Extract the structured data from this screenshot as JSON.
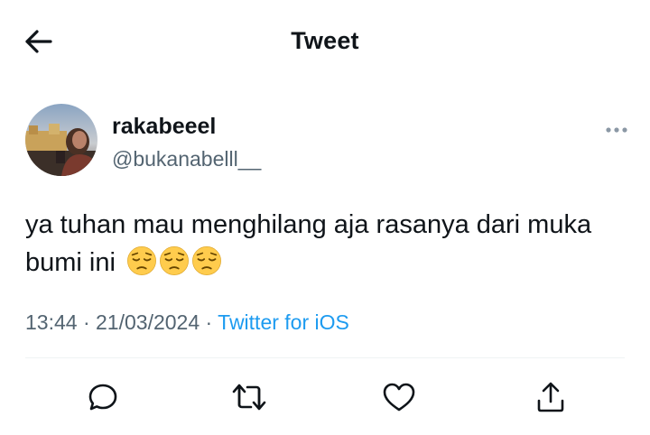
{
  "header": {
    "title": "Tweet"
  },
  "author": {
    "name": "rakabeeel",
    "handle": "@bukanabelll__"
  },
  "tweet": {
    "text": "ya tuhan mau menghilang aja rasanya dari muka bumi ini",
    "emojis": [
      "pensive-face",
      "pensive-face",
      "pensive-face"
    ]
  },
  "meta": {
    "time": "13:44",
    "sep1": " · ",
    "date": "21/03/2024",
    "sep2": " · ",
    "source": "Twitter for iOS"
  },
  "actions": [
    "reply-icon",
    "retweet-icon",
    "like-icon",
    "share-icon"
  ],
  "colors": {
    "text": "#0f1419",
    "secondary": "#536471",
    "link": "#1d9bf0",
    "divider": "#eff3f4"
  }
}
